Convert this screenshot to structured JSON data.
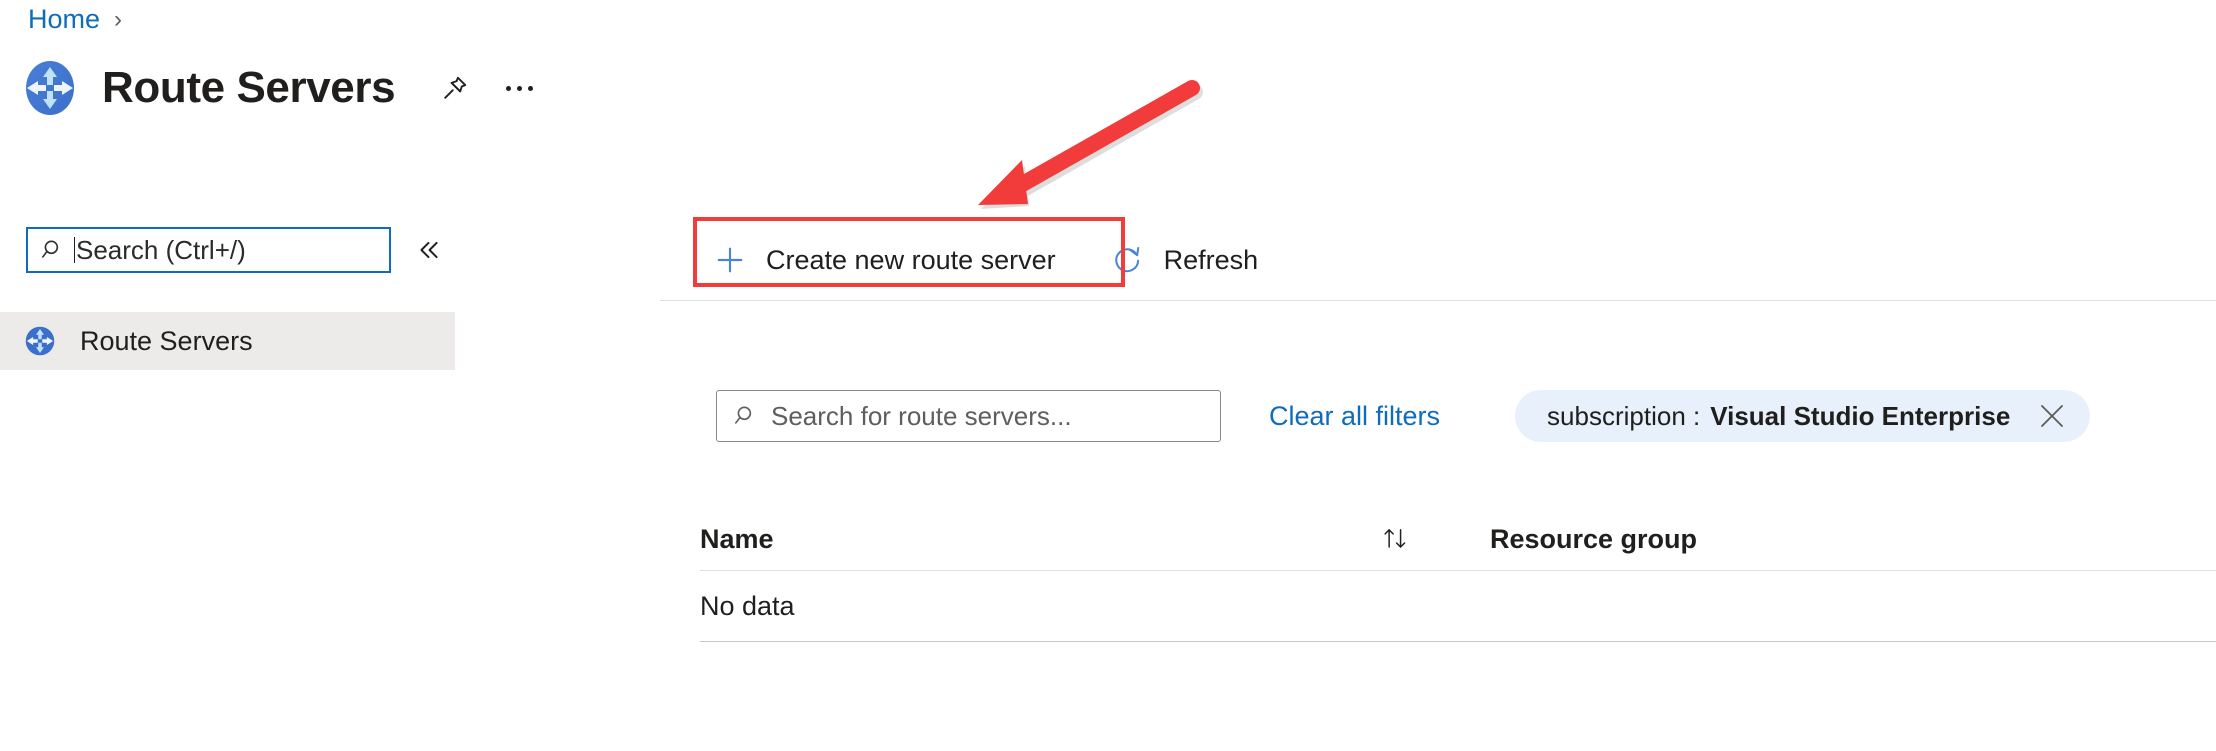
{
  "breadcrumb": {
    "items": [
      {
        "label": "Home",
        "icon": "none"
      }
    ],
    "separator": "›"
  },
  "header": {
    "icon": "route-server-icon",
    "title": "Route Servers",
    "pin_icon": "pin-icon",
    "more_icon": "ellipsis-icon"
  },
  "sidebar": {
    "search": {
      "icon": "search-icon",
      "placeholder": "Search (Ctrl+/)",
      "value": "",
      "focused": true
    },
    "collapse_icon": "chevron-double-left-icon",
    "items": [
      {
        "label": "Route Servers",
        "icon": "route-server-icon",
        "selected": true
      }
    ]
  },
  "toolbar": {
    "create_label": "Create new route server",
    "create_icon": "plus-icon",
    "refresh_label": "Refresh",
    "refresh_icon": "refresh-icon"
  },
  "filters": {
    "search": {
      "icon": "search-icon",
      "placeholder": "Search for route servers...",
      "value": ""
    },
    "clear_label": "Clear all filters",
    "pill": {
      "key": "subscription :",
      "value": "Visual Studio Enterprise",
      "close_icon": "close-icon"
    }
  },
  "table": {
    "columns": {
      "name": "Name",
      "sort_icon": "sort-ascending-descending-icon",
      "resource_group": "Resource group"
    },
    "rows": [
      {
        "name": "No data",
        "resource_group": ""
      }
    ]
  },
  "annotations": {
    "highlight_box": {
      "target": "create-new-route-server-button"
    },
    "arrow": {
      "color": "#f23b3b",
      "points_to": "create-new-route-server-button"
    }
  },
  "colors": {
    "link": "#0f6cbd",
    "accent": "#0f6cbd",
    "selected_bg": "#edebe9",
    "pill_bg": "#e8f1fb",
    "annotation_red": "#f23b3b",
    "text": "#201f1e"
  }
}
